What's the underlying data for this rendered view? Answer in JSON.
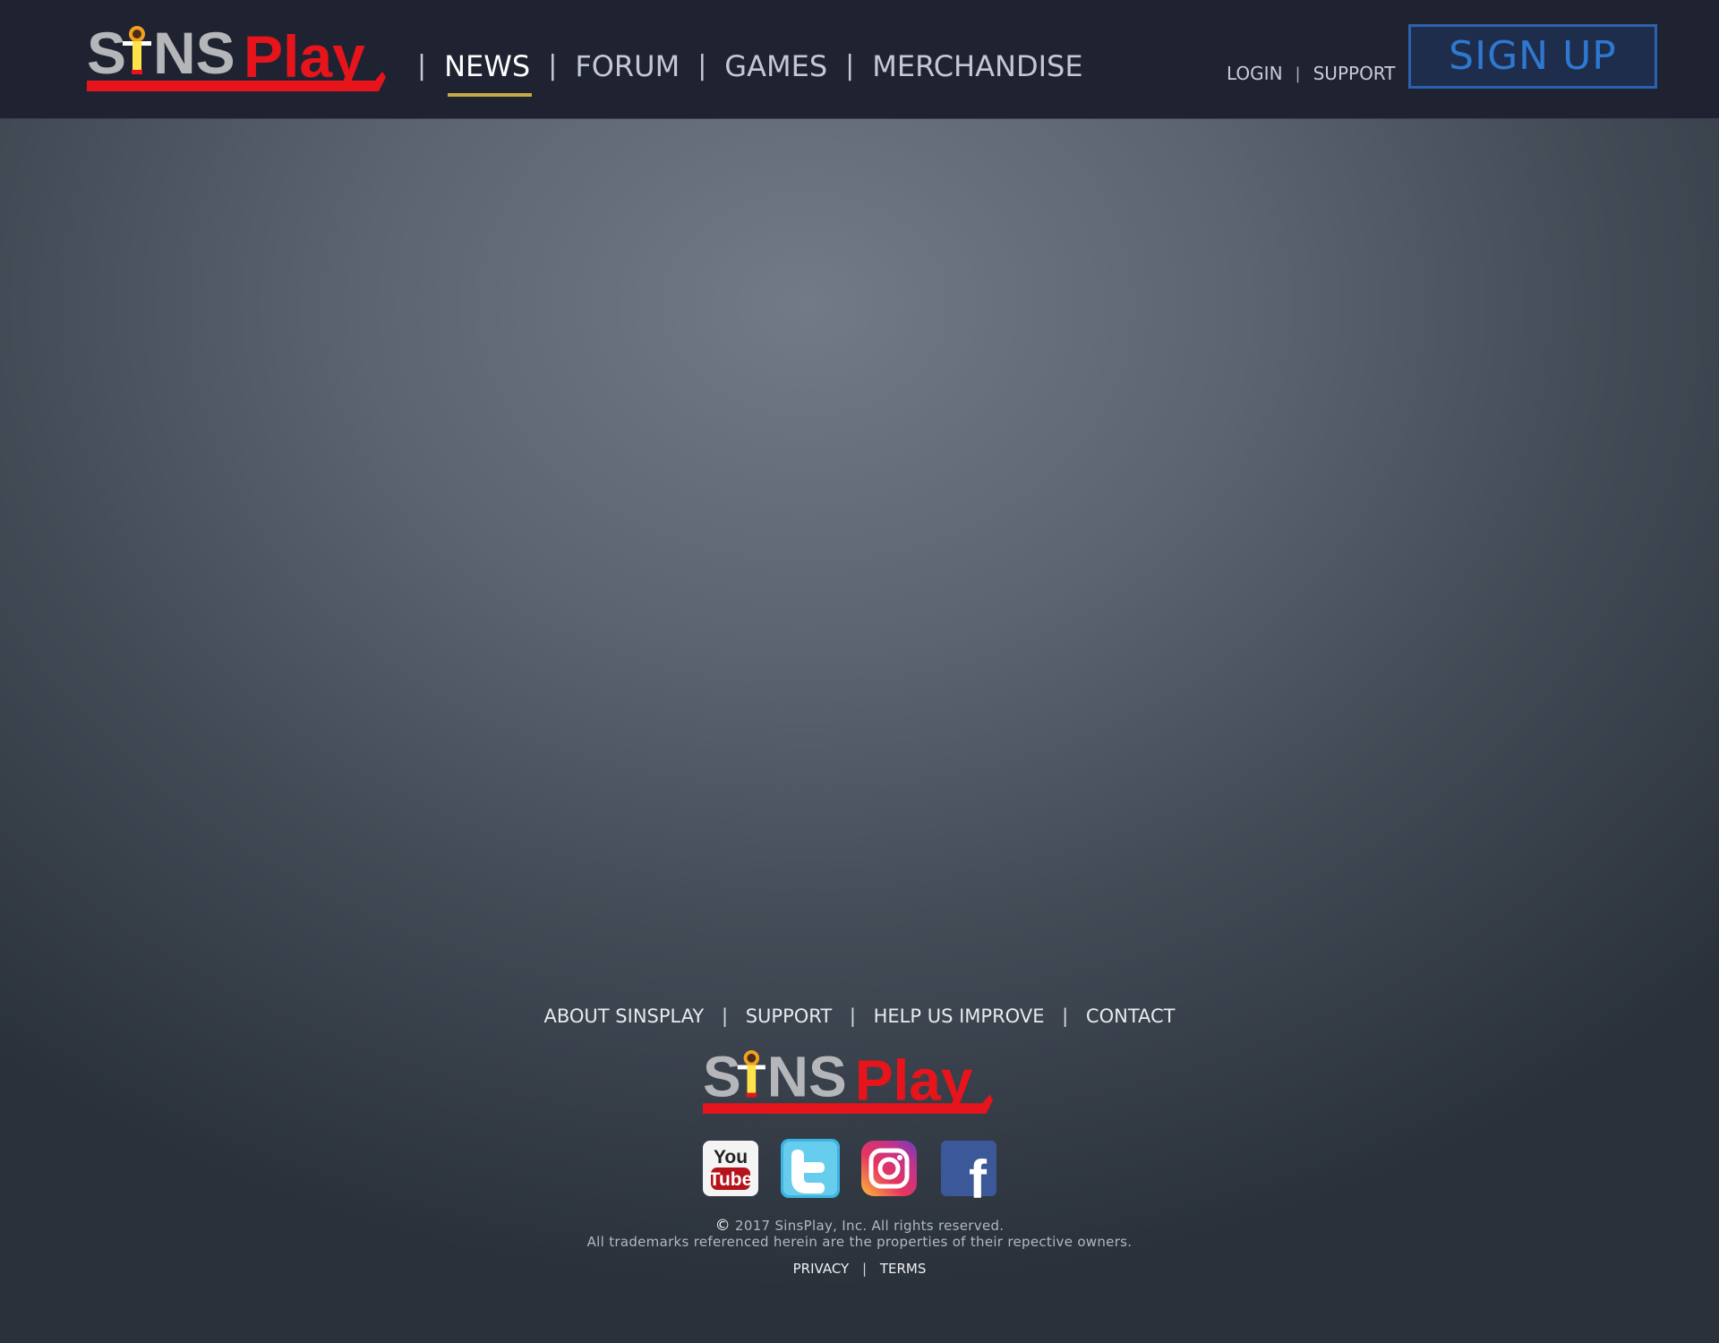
{
  "brand": {
    "name_part1": "S",
    "name_part2": "NS",
    "name_part3": "Play",
    "colors": {
      "gray": "#b5b6ba",
      "red": "#e8141b"
    }
  },
  "header": {
    "nav": [
      {
        "label": "NEWS",
        "active": true
      },
      {
        "label": "FORUM",
        "active": false
      },
      {
        "label": "GAMES",
        "active": false
      },
      {
        "label": "MERCHANDISE",
        "active": false
      }
    ],
    "separator": "|",
    "login_label": "LOGIN",
    "support_label": "SUPPORT",
    "signup_label": "SIGN UP"
  },
  "footer": {
    "links": [
      {
        "label": "ABOUT SINSPLAY"
      },
      {
        "label": "SUPPORT"
      },
      {
        "label": "HELP US IMPROVE"
      },
      {
        "label": "CONTACT"
      }
    ],
    "social": [
      {
        "icon": "youtube-icon",
        "text_top": "You",
        "text_bottom": "Tube"
      },
      {
        "icon": "twitter-icon"
      },
      {
        "icon": "instagram-icon"
      },
      {
        "icon": "facebook-icon",
        "text": "f"
      }
    ],
    "copyright_line1": "2017 SinsPlay, Inc. All rights reserved.",
    "copyright_symbol": "©",
    "copyright_line2": "All trademarks referenced herein are the properties of their repective owners.",
    "privacy_label": "PRIVACY",
    "terms_label": "TERMS"
  },
  "colors": {
    "header_bg": "#1f2331",
    "active_underline": "#c9a84a",
    "signup_border": "#2c62ad",
    "signup_text": "#2f78d0"
  }
}
